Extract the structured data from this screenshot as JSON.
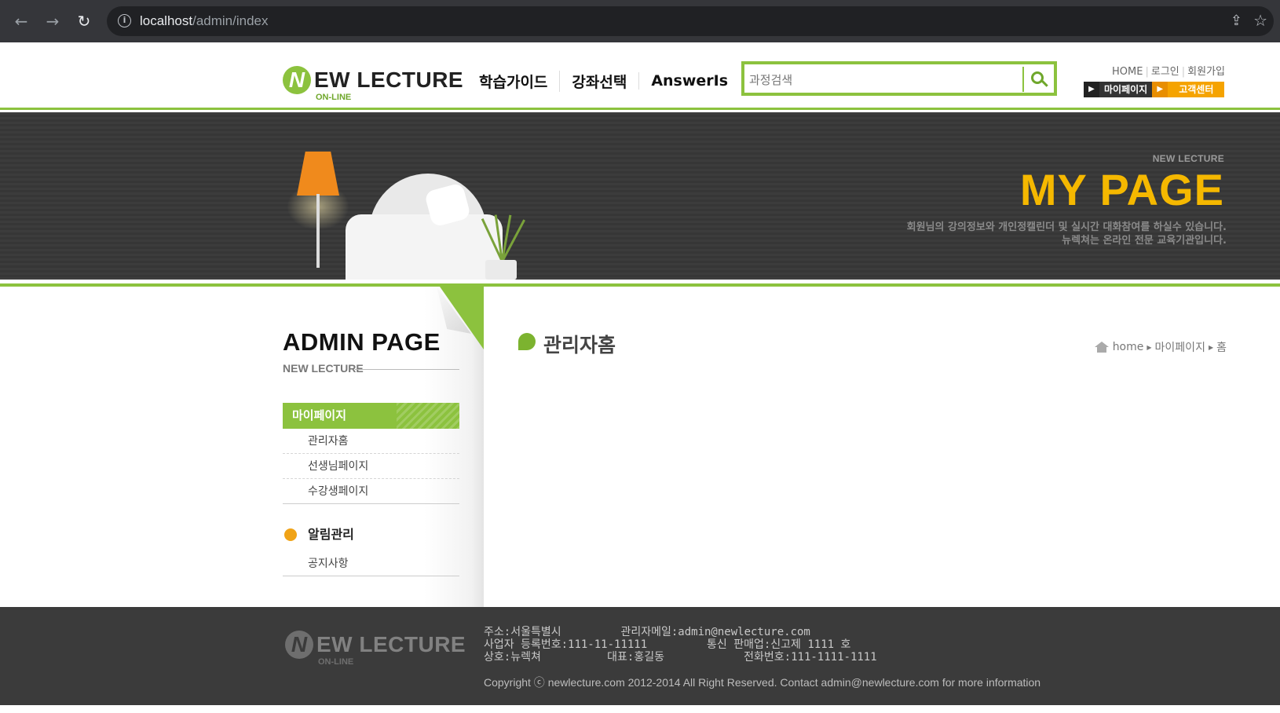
{
  "browser": {
    "url_host": "localhost",
    "url_path": "/admin/index"
  },
  "header": {
    "logo_main": "EW LECTURE",
    "logo_letter": "N",
    "logo_sub": "ON-LINE",
    "nav": [
      "학습가이드",
      "강좌선택",
      "AnswerIs"
    ],
    "search_placeholder": "과정검색",
    "util_links": [
      "HOME",
      "로그인",
      "회원가입"
    ],
    "btn_mypage": "마이페이지",
    "btn_support": "고객센터"
  },
  "banner": {
    "subtitle": "NEW LECTURE",
    "title": "MY PAGE",
    "desc_line1": "회원님의 강의정보와 개인정캘린더 및 실시간 대화참여를 하실수 있습니다.",
    "desc_line2": "뉴렉쳐는 온라인 전문 교육기관입니다."
  },
  "sidebar": {
    "title": "ADMIN PAGE",
    "subtitle": "NEW LECTURE",
    "menu_head": "마이페이지",
    "items": [
      "관리자홈",
      "선생님페이지",
      "수강생페이지"
    ],
    "group_title": "알림관리",
    "group_items": [
      "공지사항"
    ]
  },
  "content": {
    "title": "관리자홈",
    "breadcrumb": [
      "home",
      "마이페이지",
      "홈"
    ]
  },
  "footer": {
    "address": "주소:서울특별시",
    "admin_mail": "관리자메일:admin@newlecture.com",
    "biz_no": "사업자 등록번호:111-11-11111",
    "sales_no": "통신 판매업:신고제 1111 호",
    "company": "상호:뉴렉쳐",
    "ceo": "대표:홍길동",
    "phone": "전화번호:111-1111-1111",
    "copyright": "Copyright ⓒ newlecture.com 2012-2014 All Right Reserved. Contact admin@newlecture.com for more information"
  },
  "colors": {
    "accent_green": "#8cc23e",
    "banner_yellow": "#f5b800",
    "orange": "#f5a300"
  }
}
